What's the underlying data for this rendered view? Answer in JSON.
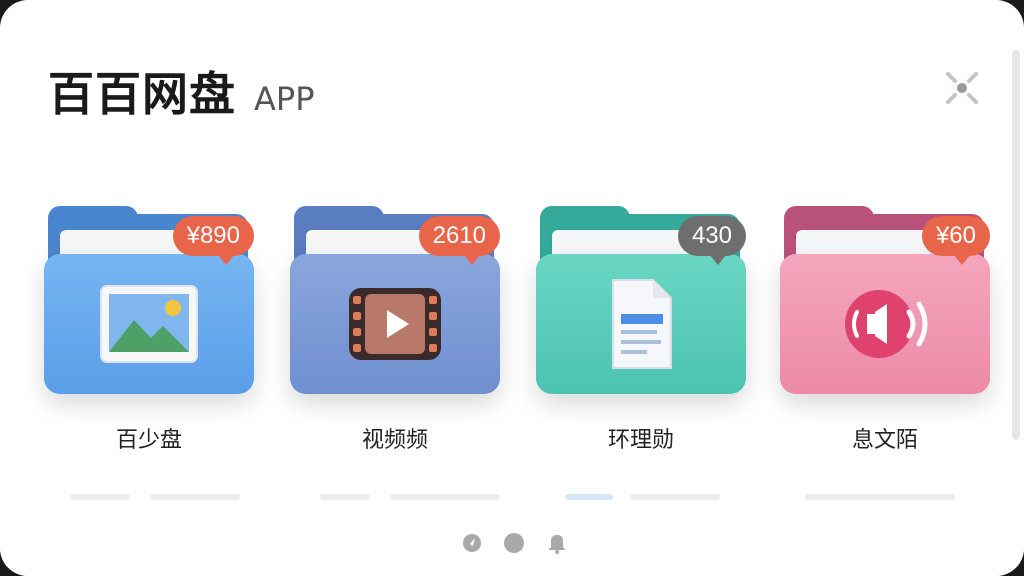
{
  "header": {
    "title": "百百网盘",
    "subtitle": "APP"
  },
  "icons": {
    "close": "close-icon",
    "picture": "image-icon",
    "video": "video-icon",
    "document": "document-icon",
    "audio": "audio-icon"
  },
  "folders": [
    {
      "label": "百少盘",
      "badge": "¥890",
      "color": "#5fa6ee",
      "badge_color": "#e8654a"
    },
    {
      "label": "视频频",
      "badge": "2610",
      "color": "#7a9ad4",
      "badge_color": "#e8654a"
    },
    {
      "label": "环理勋",
      "badge": "430",
      "color": "#55c9b6",
      "badge_color": "#6e6e6e"
    },
    {
      "label": "息文陌",
      "badge": "¥60",
      "color": "#ef8faa",
      "badge_color": "#e8654a"
    }
  ],
  "nav": [
    "compass-icon",
    "dot-icon",
    "bell-icon"
  ]
}
